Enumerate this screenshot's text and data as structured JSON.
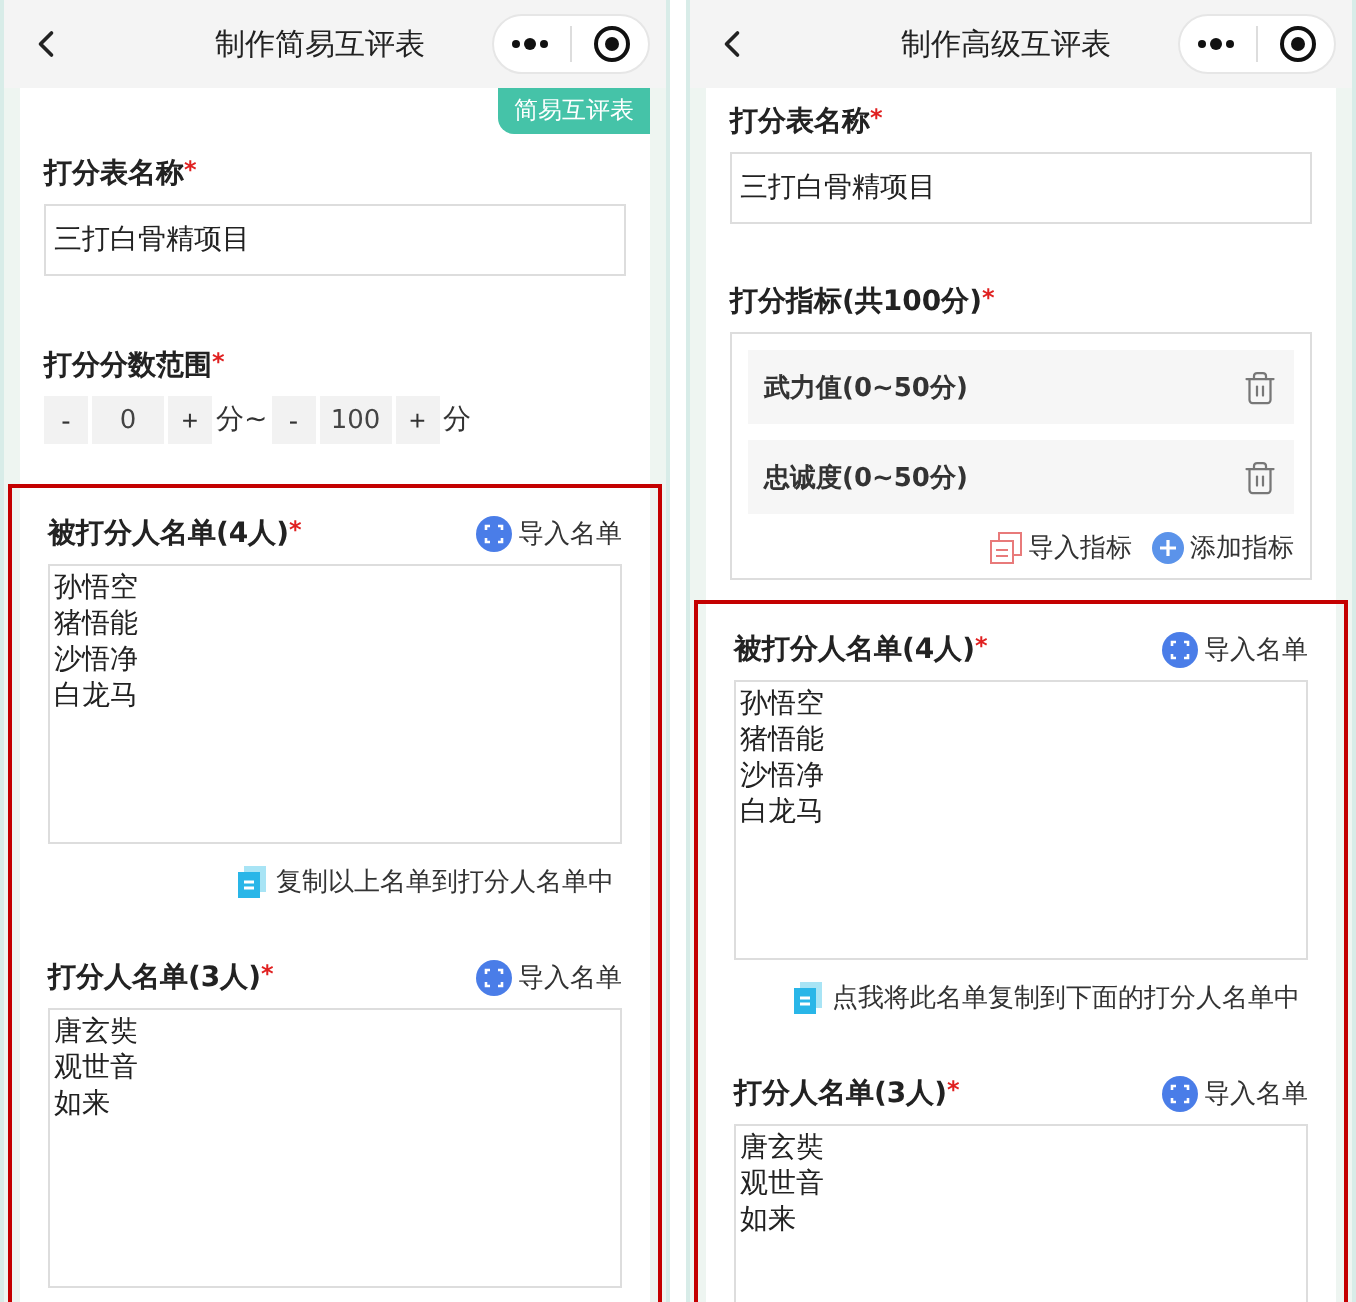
{
  "panels": [
    {
      "header": {
        "title": "制作简易互评表"
      },
      "badge": "简易互评表",
      "sections": [
        {
          "kind": "text",
          "label": "打分表名称",
          "mark": "*",
          "value": "三打白骨精项目"
        },
        {
          "kind": "range",
          "label": "打分分数范围",
          "mark": "*",
          "parts": [
            {
              "kind": "step",
              "text": "-"
            },
            {
              "kind": "value",
              "text": "0"
            },
            {
              "kind": "step",
              "text": "+"
            },
            {
              "kind": "unit",
              "text": "分~"
            },
            {
              "kind": "step",
              "text": "-"
            },
            {
              "kind": "value",
              "text": "100"
            },
            {
              "kind": "step",
              "text": "+"
            },
            {
              "kind": "unit",
              "text": "分"
            }
          ]
        }
      ],
      "highlighted": [
        {
          "kind": "list",
          "label": "被打分人名单(4人)",
          "mark": "*",
          "import": "导入名单",
          "lines": [
            "孙悟空",
            "猪悟能",
            "沙悟净",
            "白龙马"
          ],
          "copy": "复制以上名单到打分人名单中"
        },
        {
          "kind": "list",
          "label": "打分人名单(3人)",
          "mark": "*",
          "import": "导入名单",
          "lines": [
            "唐玄奘",
            "观世音",
            "如来"
          ]
        }
      ]
    },
    {
      "header": {
        "title": "制作高级互评表"
      },
      "sections": [
        {
          "kind": "text",
          "label": "打分表名称",
          "mark": "*",
          "value": "三打白骨精项目"
        },
        {
          "kind": "criteria",
          "label": "打分指标(共100分)",
          "mark": "*",
          "items": [
            "武力值(0~50分)",
            "忠诚度(0~50分)"
          ],
          "import": "导入指标",
          "add": "添加指标"
        }
      ],
      "highlighted": [
        {
          "kind": "list",
          "label": "被打分人名单(4人)",
          "mark": "*",
          "import": "导入名单",
          "lines": [
            "孙悟空",
            "猪悟能",
            "沙悟净",
            "白龙马"
          ],
          "copy": "点我将此名单复制到下面的打分人名单中"
        },
        {
          "kind": "list",
          "label": "打分人名单(3人)",
          "mark": "*",
          "import": "导入名单",
          "lines": [
            "唐玄奘",
            "观世音",
            "如来"
          ]
        }
      ]
    }
  ]
}
